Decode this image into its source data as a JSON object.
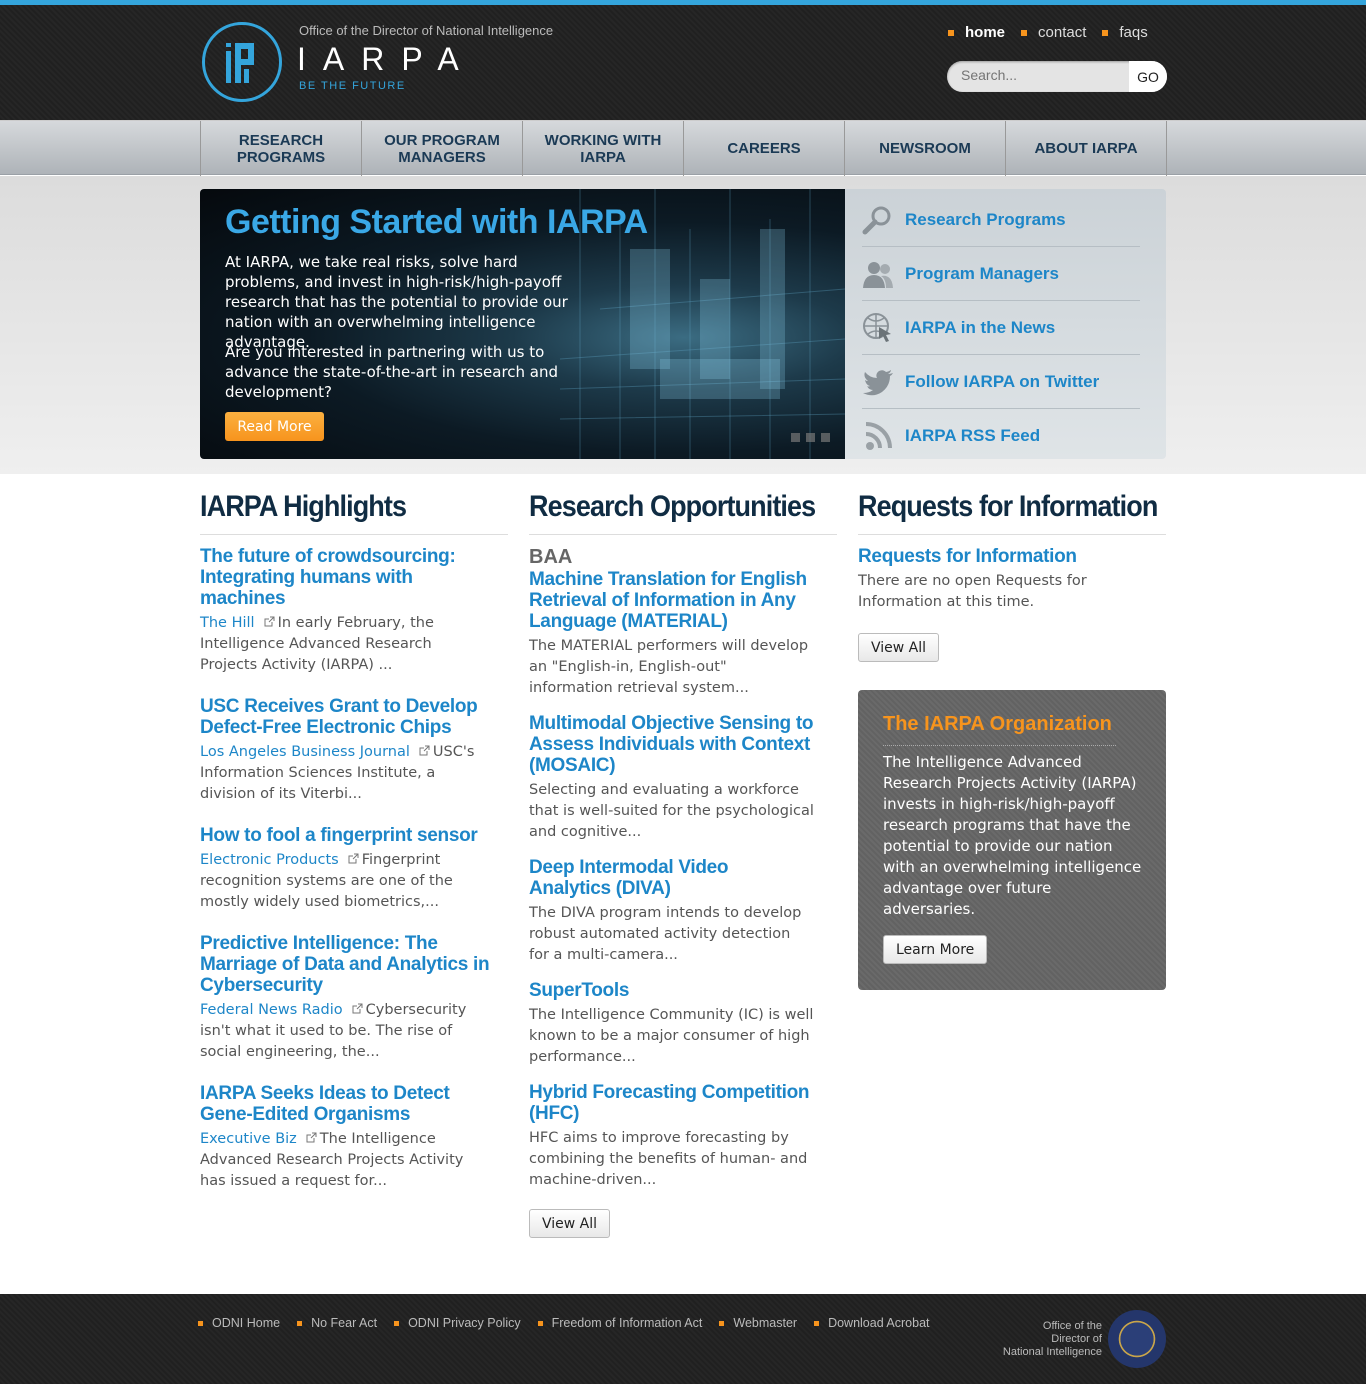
{
  "colors": {
    "accent": "#34a5dc",
    "link": "#1d86c8",
    "orange": "#f7941d",
    "heading": "#102c43"
  },
  "header": {
    "odni": "Office of the Director of National Intelligence",
    "wordmark": "IARPA",
    "tagline": "BE THE FUTURE",
    "top_nav": [
      {
        "label": "home",
        "active": true
      },
      {
        "label": "contact"
      },
      {
        "label": "faqs"
      }
    ],
    "search": {
      "placeholder": "Search...",
      "button": "GO"
    }
  },
  "main_nav": [
    "Research Programs",
    "Our Program Managers",
    "Working With IARPA",
    "Careers",
    "Newsroom",
    "About IARPA"
  ],
  "hero": {
    "title": "Getting Started with IARPA",
    "p1": "At IARPA, we take real risks, solve hard problems, and invest in high-risk/high-payoff research that has the potential to provide our nation with an overwhelming intelligence advantage.",
    "p2": "Are you interested in partnering with us to advance the state-of-the-art in research and development?",
    "button": "Read More"
  },
  "quick_links": [
    {
      "label": "Research Programs",
      "icon": "magnifier-icon"
    },
    {
      "label": "Program Managers",
      "icon": "people-icon"
    },
    {
      "label": "IARPA in the News",
      "icon": "globe-cursor-icon"
    },
    {
      "label": "Follow IARPA on Twitter",
      "icon": "twitter-bird-icon"
    },
    {
      "label": "IARPA RSS Feed",
      "icon": "rss-icon"
    }
  ],
  "highlights": {
    "heading": "IARPA Highlights",
    "items": [
      {
        "title": "The future of crowdsourcing: Integrating humans with machines",
        "source": "The Hill",
        "text": "In early February, the Intelligence Advanced Research Projects Activity (IARPA) ..."
      },
      {
        "title": "USC Receives Grant to Develop Defect-Free Electronic Chips",
        "source": "Los Angeles Business Journal",
        "text": "USC's Information Sciences Institute, a division of its Viterbi..."
      },
      {
        "title": "How to fool a fingerprint sensor",
        "source": "Electronic Products",
        "text": "Fingerprint recognition systems are one of the mostly widely used biometrics,..."
      },
      {
        "title": "Predictive Intelligence: The Marriage of Data and Analytics in Cybersecurity",
        "source": "Federal News Radio",
        "text": "Cybersecurity isn't what it used to be. The rise of social engineering, the..."
      },
      {
        "title": "IARPA Seeks Ideas to Detect Gene-Edited Organisms",
        "source": "Executive Biz",
        "text": "The Intelligence Advanced Research Projects Activity has issued a request for..."
      }
    ]
  },
  "research": {
    "heading": "Research Opportunities",
    "subheading": "BAA",
    "items": [
      {
        "title": "Machine Translation for English Retrieval of Information in Any Language (MATERIAL)",
        "text": "The MATERIAL performers will develop an \"English-in, English-out\" information retrieval system..."
      },
      {
        "title": "Multimodal Objective Sensing to Assess Individuals with Context (MOSAIC)",
        "text": "Selecting and evaluating a workforce that is well-suited for the psychological and cognitive..."
      },
      {
        "title": "Deep Intermodal Video Analytics (DIVA)",
        "text": "The DIVA program intends to develop robust automated activity detection for a multi-camera..."
      },
      {
        "title": "SuperTools",
        "text": "The Intelligence Community (IC) is well known to be a major consumer of high performance..."
      },
      {
        "title": "Hybrid Forecasting Competition (HFC)",
        "text": "HFC aims to improve forecasting by combining the benefits of human- and machine-driven..."
      }
    ],
    "button": "View All"
  },
  "rfi": {
    "heading": "Requests for Information",
    "title": "Requests for Information",
    "text": "There are no open Requests for Information at this time.",
    "button": "View All"
  },
  "org": {
    "title": "The IARPA Organization",
    "text": "The Intelligence Advanced Research Projects Activity (IARPA) invests in high-risk/high-payoff research programs that have the potential to provide our nation with an overwhelming intelligence advantage over future adversaries.",
    "button": "Learn More"
  },
  "footer": {
    "links": [
      "ODNI Home",
      "No Fear Act",
      "ODNI Privacy Policy",
      "Freedom of Information Act",
      "Webmaster",
      "Download Acrobat"
    ],
    "odni_1": "Office of the",
    "odni_2": "Director of",
    "odni_3": "National Intelligence"
  }
}
